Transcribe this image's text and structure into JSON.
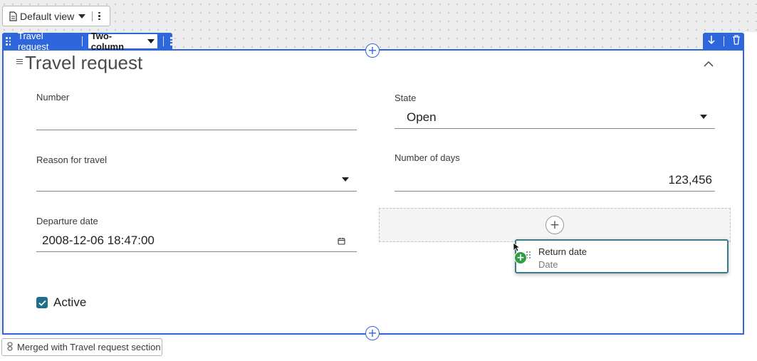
{
  "view_bar": {
    "icon": "document-icon",
    "view_name": "Default view",
    "more_icon": "more-vertical-icon"
  },
  "section_tab": {
    "title": "Travel request",
    "layout_label": "Two-column",
    "actions": [
      "arrow-down-icon",
      "trash-icon"
    ]
  },
  "section": {
    "heading": "Travel request",
    "collapse_icon": "chevron-up-icon",
    "accent_color": "#2e66dc"
  },
  "fields": {
    "number": {
      "label": "Number",
      "value": ""
    },
    "state": {
      "label": "State",
      "value": "Open"
    },
    "reason": {
      "label": "Reason for travel",
      "value": ""
    },
    "days": {
      "label": "Number of days",
      "value": "123,456"
    },
    "departure": {
      "label": "Departure date",
      "value": "2008-12-06 18:47:00",
      "icon": "calendar-icon"
    },
    "active": {
      "label": "Active",
      "checked": true
    }
  },
  "drag_card": {
    "name": "Return date",
    "type": "Date",
    "badge_icon": "add-plus-icon",
    "badge_color": "#2f9e44"
  },
  "merged_badge": {
    "icon": "link-icon",
    "text": "Merged with Travel request section"
  }
}
